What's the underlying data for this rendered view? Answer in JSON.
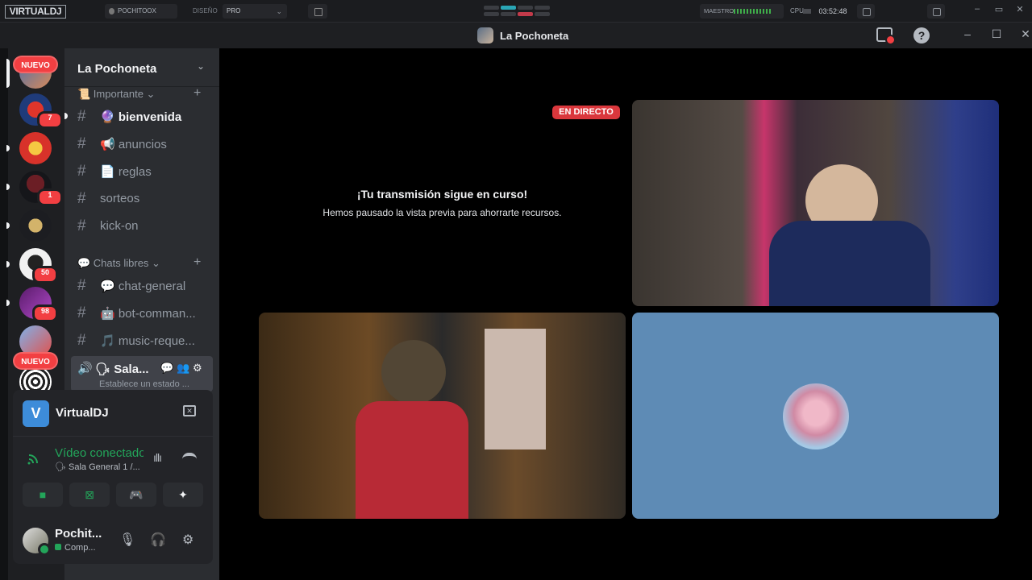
{
  "vdj": {
    "logo": "VIRTUALDJ",
    "user": "POCHITOOX",
    "diseno_label": "DISEÑO",
    "diseno_value": "PRO",
    "maestro_label": "MAESTRO",
    "cpu_label": "CPU",
    "clock": "03:52:48"
  },
  "titlebar": {
    "server_name": "La Pochoneta",
    "help": "?"
  },
  "rail": {
    "new_badge_1": "NUEVO",
    "new_badge_2": "NUEVO",
    "badges": [
      "7",
      "1",
      "50",
      "98"
    ]
  },
  "guild": {
    "name": "La Pochoneta",
    "categories": [
      {
        "label": "📜 Importante ⌄"
      },
      {
        "label": "💬 Chats libres ⌄"
      }
    ],
    "channels": [
      {
        "label": "🔮 bienvenida"
      },
      {
        "label": "📢 anuncios"
      },
      {
        "label": "📄 reglas"
      },
      {
        "label": "sorteos"
      },
      {
        "label": "kick-on"
      },
      {
        "label": "💬 chat-general"
      },
      {
        "label": "🤖 bot-comman..."
      },
      {
        "label": "🎵 music-reque..."
      }
    ],
    "voice_channel": {
      "name": "🗣 Sala...",
      "status": "Establece un estado ..."
    }
  },
  "panels": {
    "activity_app": "VirtualDJ",
    "activity_icon": "V",
    "rtc_status": "Vídeo conectado",
    "rtc_sub": "🗣 Sala General 1 /...",
    "user_name": "Pochit...",
    "user_status": "Comp..."
  },
  "stage": {
    "live_label": "EN DIRECTO",
    "paused_title": "¡Tu transmisión sigue en curso!",
    "paused_sub": "Hemos pausado la vista previa para ahorrarte recursos."
  },
  "colors": {
    "accent_red": "#da373c",
    "connected_green": "#23a55a",
    "sidebar_bg": "#2b2d31",
    "rail_bg": "#1e1f22",
    "tile_blue": "#5e8bb5"
  }
}
